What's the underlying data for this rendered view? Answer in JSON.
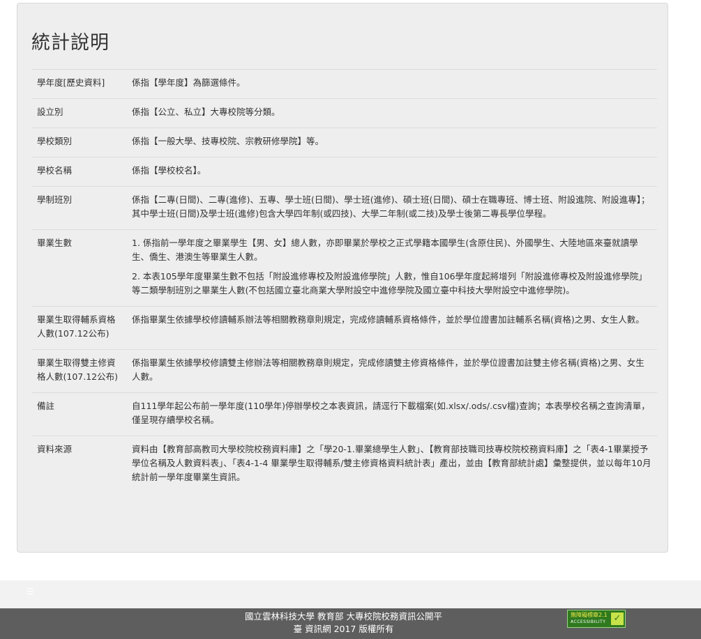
{
  "panel": {
    "title": "統計說明",
    "rows": [
      {
        "term": "學年度[歷史資料]",
        "desc": [
          "係指【學年度】為篩選條件。"
        ]
      },
      {
        "term": "設立別",
        "desc": [
          "係指【公立、私立】大專校院等分類。"
        ]
      },
      {
        "term": "學校類別",
        "desc": [
          "係指【一般大學、技專校院、宗教研修學院】等。"
        ]
      },
      {
        "term": "學校名稱",
        "desc": [
          "係指【學校校名】。"
        ]
      },
      {
        "term": "學制班別",
        "desc": [
          "係指【二專(日間)、二專(進修)、五專、學士班(日間)、學士班(進修)、碩士班(日間)、碩士在職專班、博士班、附設進院、附設進專】；其中學士班(日間)及學士班(進修)包含大學四年制(或四技)、大學二年制(或二技)及學士後第二專長學位學程。"
        ]
      },
      {
        "term": "畢業生數",
        "desc": [
          "1. 係指前一學年度之畢業學生【男、女】總人數，亦即畢業於學校之正式學籍本國學生(含原住民)、外國學生、大陸地區來臺就讀學生、僑生、港澳生等畢業生人數。",
          "2. 本表105學年度畢業生數不包括「附設進修專校及附設進修學院」人數，惟自106學年度起將增列「附設進修專校及附設進修學院」等二類學制班別之畢業生人數(不包括國立臺北商業大學附設空中進修學院及國立臺中科技大學附設空中進修學院)。"
        ]
      },
      {
        "term": "畢業生取得輔系資格人數(107.12公布)",
        "desc": [
          "係指畢業生依據學校修讀輔系辦法等相關教務章則規定，完成修讀輔系資格條件，並於學位證書加註輔系名稱(資格)之男、女生人數。"
        ]
      },
      {
        "term": "畢業生取得雙主修資格人數(107.12公布)",
        "desc": [
          "係指畢業生依據學校修讀雙主修辦法等相關教務章則規定，完成修讀雙主修資格條件，並於學位證書加註雙主修名稱(資格)之男、女生人數。"
        ]
      },
      {
        "term": "備註",
        "desc": [
          "自111學年起公布前一學年度(110學年)停辦學校之本表資訊，請逕行下載檔案(如.xlsx/.ods/.csv檔)查詢；本表學校名稱之查詢清單，僅呈現存續學校名稱。"
        ]
      },
      {
        "term": "資料來源",
        "desc": [
          "資料由【教育部高教司大學校院校務資料庫】之「學20-1.畢業總學生人數」、【教育部技職司技專校院校務資料庫】之「表4-1畢業授予學位名稱及人數資料表」、「表4-1-4 畢業學生取得輔系/雙主修資格資料統計表」產出，並由【教育部統計處】彙整提供，並以每年10月統計前一學年度畢業生資訊。"
        ]
      }
    ]
  },
  "footer": {
    "line1": "國立雲林科技大學 教育部 大專校院校務資訊公開平",
    "line2": "臺 資訊網 2017 版權所有",
    "badge_text": "無障礙標章2.1",
    "badge_sub": "ACCESSIBILITY",
    "badge_icon": "check-icon"
  },
  "nav": {
    "menu_icon": "menu-icon"
  },
  "colors": {
    "panel_bg": "#eeeeee",
    "footer_bg": "#5e5e5e",
    "badge_bg": "#2f7a1e"
  }
}
